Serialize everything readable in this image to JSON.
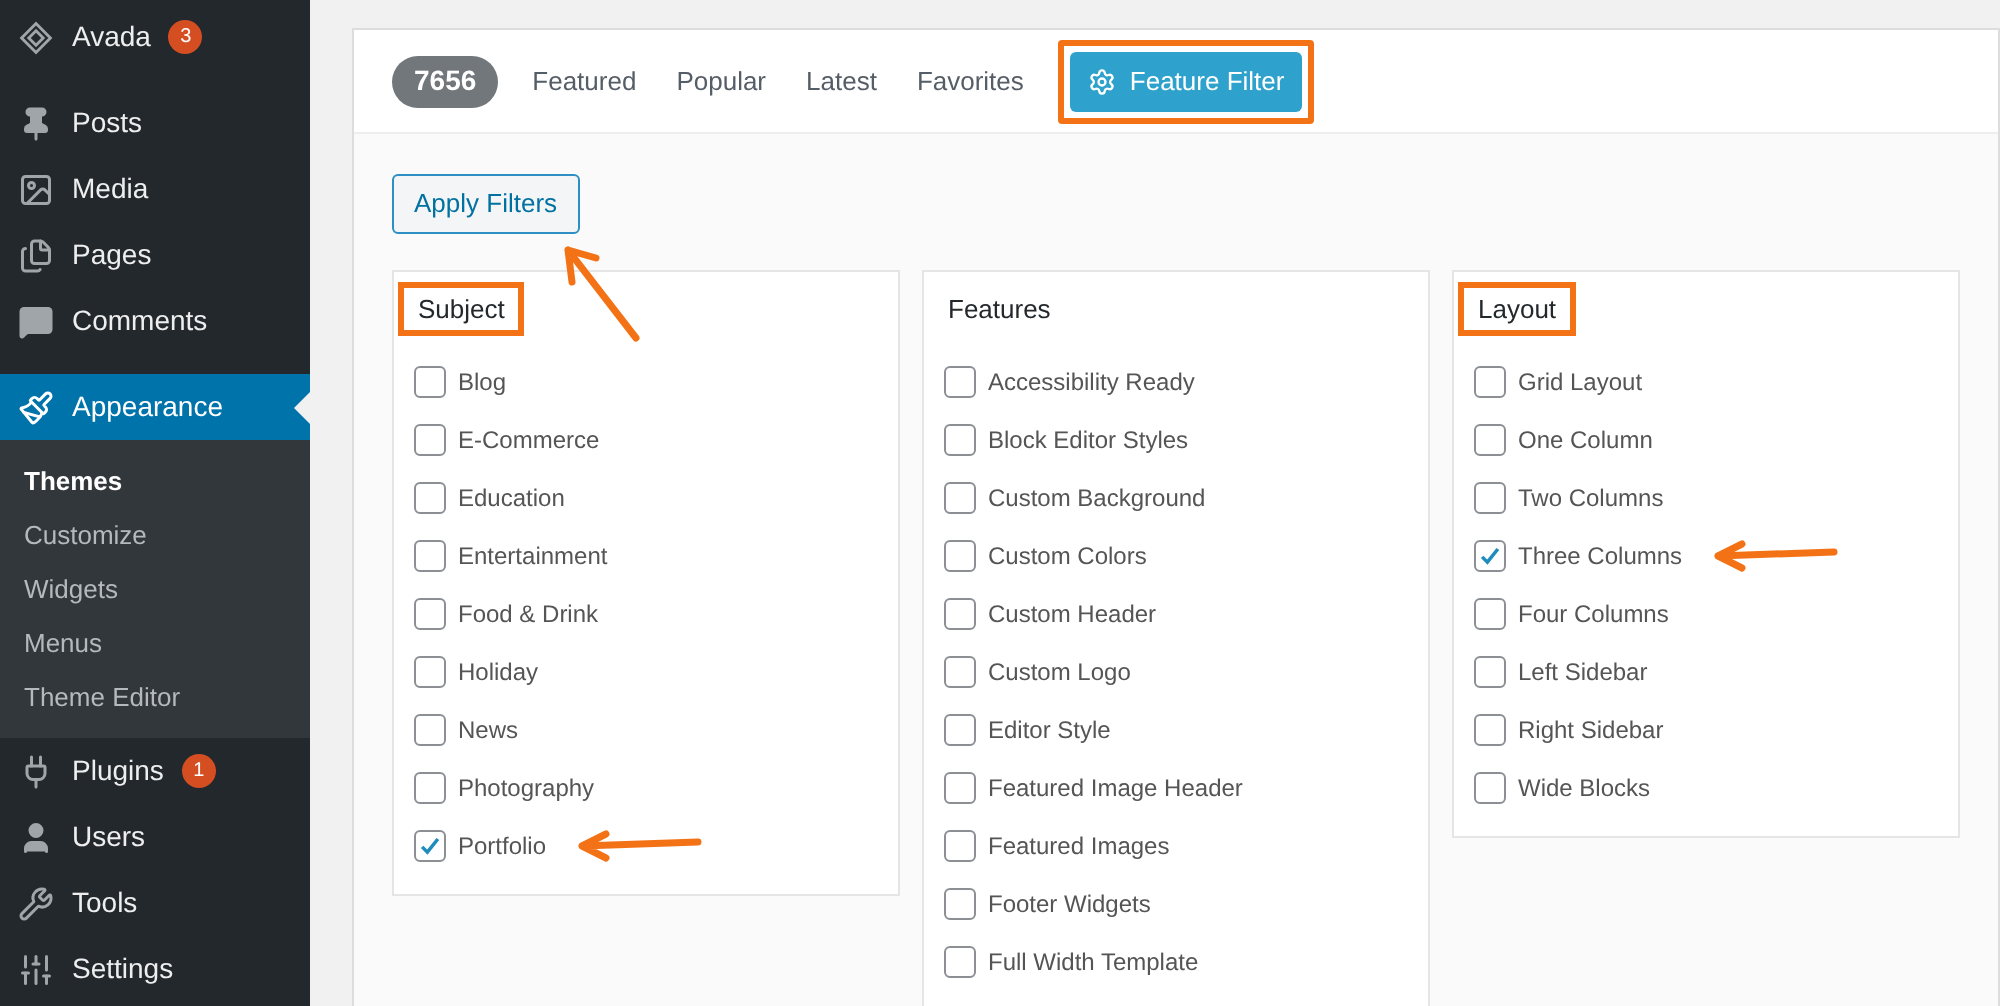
{
  "sidebar": {
    "items": [
      {
        "label": "Avada",
        "badge": "3",
        "selected": false
      },
      {
        "label": "Posts",
        "selected": false
      },
      {
        "label": "Media",
        "selected": false
      },
      {
        "label": "Pages",
        "selected": false
      },
      {
        "label": "Comments",
        "selected": false
      },
      {
        "label": "Appearance",
        "selected": true,
        "children": [
          {
            "label": "Themes",
            "selected": true
          },
          {
            "label": "Customize",
            "selected": false
          },
          {
            "label": "Widgets",
            "selected": false
          },
          {
            "label": "Menus",
            "selected": false
          },
          {
            "label": "Theme Editor",
            "selected": false
          }
        ]
      },
      {
        "label": "Plugins",
        "badge": "1",
        "selected": false
      },
      {
        "label": "Users",
        "selected": false
      },
      {
        "label": "Tools",
        "selected": false
      },
      {
        "label": "Settings",
        "selected": false
      }
    ]
  },
  "count": "7656",
  "tabs": [
    {
      "label": "Featured",
      "selected": false,
      "highlighted": false
    },
    {
      "label": "Popular",
      "selected": false,
      "highlighted": false
    },
    {
      "label": "Latest",
      "selected": false,
      "highlighted": false
    },
    {
      "label": "Favorites",
      "selected": false,
      "highlighted": false
    },
    {
      "label": "Feature Filter",
      "selected": true,
      "highlighted": true
    }
  ],
  "apply_button": {
    "label": "Apply Filters",
    "arrow": true
  },
  "filter_groups": [
    {
      "heading": "Subject",
      "highlighted": true,
      "options": [
        {
          "label": "Blog",
          "checked": false,
          "arrow": false
        },
        {
          "label": "E-Commerce",
          "checked": false,
          "arrow": false
        },
        {
          "label": "Education",
          "checked": false,
          "arrow": false
        },
        {
          "label": "Entertainment",
          "checked": false,
          "arrow": false
        },
        {
          "label": "Food & Drink",
          "checked": false,
          "arrow": false
        },
        {
          "label": "Holiday",
          "checked": false,
          "arrow": false
        },
        {
          "label": "News",
          "checked": false,
          "arrow": false
        },
        {
          "label": "Photography",
          "checked": false,
          "arrow": false
        },
        {
          "label": "Portfolio",
          "checked": true,
          "arrow": true
        }
      ]
    },
    {
      "heading": "Features",
      "highlighted": false,
      "options": [
        {
          "label": "Accessibility Ready",
          "checked": false,
          "arrow": false
        },
        {
          "label": "Block Editor Styles",
          "checked": false,
          "arrow": false
        },
        {
          "label": "Custom Background",
          "checked": false,
          "arrow": false
        },
        {
          "label": "Custom Colors",
          "checked": false,
          "arrow": false
        },
        {
          "label": "Custom Header",
          "checked": false,
          "arrow": false
        },
        {
          "label": "Custom Logo",
          "checked": false,
          "arrow": false
        },
        {
          "label": "Editor Style",
          "checked": false,
          "arrow": false
        },
        {
          "label": "Featured Image Header",
          "checked": false,
          "arrow": false
        },
        {
          "label": "Featured Images",
          "checked": false,
          "arrow": false
        },
        {
          "label": "Footer Widgets",
          "checked": false,
          "arrow": false
        },
        {
          "label": "Full Width Template",
          "checked": false,
          "arrow": false
        }
      ]
    },
    {
      "heading": "Layout",
      "highlighted": true,
      "options": [
        {
          "label": "Grid Layout",
          "checked": false,
          "arrow": false
        },
        {
          "label": "One Column",
          "checked": false,
          "arrow": false
        },
        {
          "label": "Two Columns",
          "checked": false,
          "arrow": false
        },
        {
          "label": "Three Columns",
          "checked": true,
          "arrow": true
        },
        {
          "label": "Four Columns",
          "checked": false,
          "arrow": false
        },
        {
          "label": "Left Sidebar",
          "checked": false,
          "arrow": false
        },
        {
          "label": "Right Sidebar",
          "checked": false,
          "arrow": false
        },
        {
          "label": "Wide Blocks",
          "checked": false,
          "arrow": false
        }
      ]
    }
  ]
}
